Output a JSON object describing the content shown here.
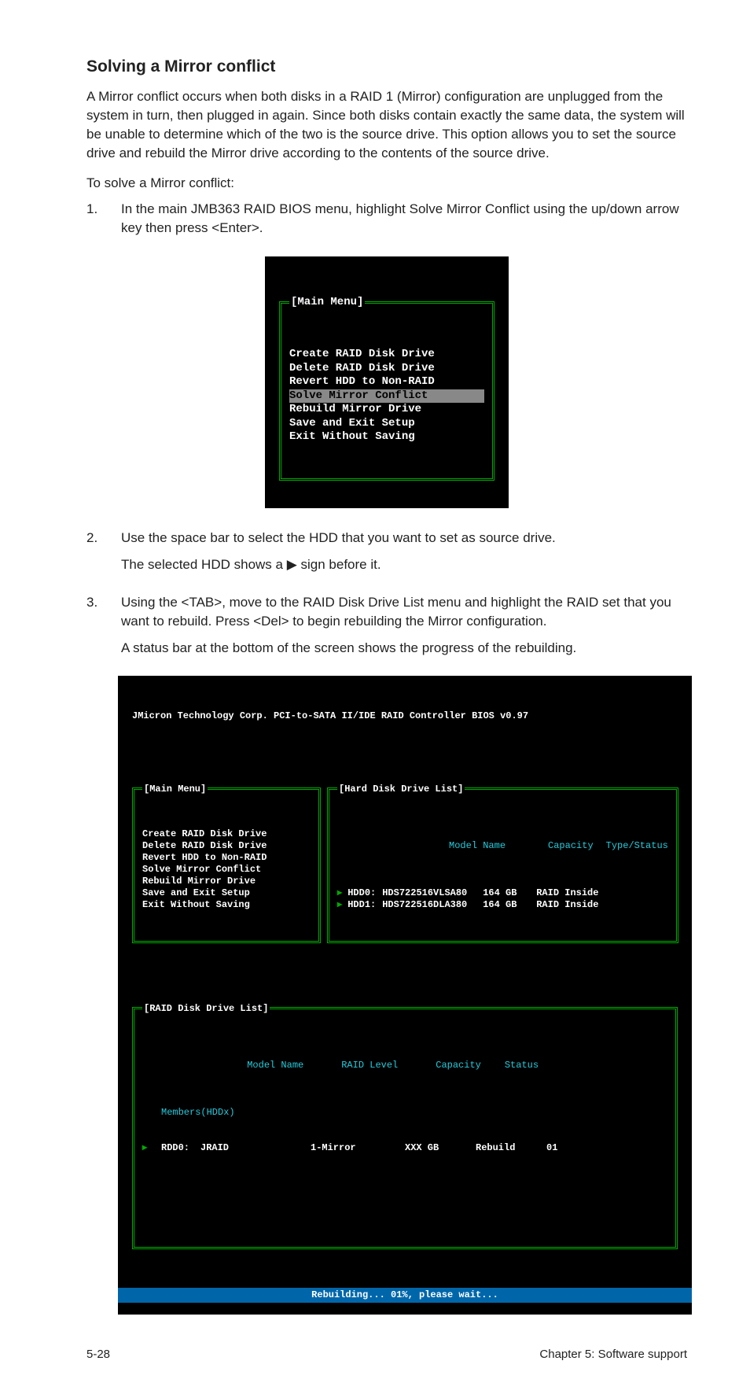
{
  "section": {
    "title": "Solving a Mirror conflict",
    "intro": "A Mirror conflict occurs when both disks in a RAID 1 (Mirror) configuration are unplugged from the system in turn, then plugged in again. Since both disks contain exactly the same data, the system will be unable to determine which of the two is the source drive. This option allows you to set the source drive and rebuild the Mirror drive according to the contents of the source drive.",
    "lead": "To solve a Mirror conflict:",
    "steps": [
      {
        "num": "1.",
        "text": "In the main JMB363 RAID BIOS menu, highlight Solve Mirror Conflict using the up/down arrow key then press <Enter>."
      },
      {
        "num": "2.",
        "text": "Use the space bar to select the HDD that you want to set as source drive.",
        "extra": "The selected HDD shows a ▶ sign before it."
      },
      {
        "num": "3.",
        "text": "Using the <TAB>, move to the RAID Disk Drive List menu and highlight the RAID set that you want to rebuild. Press <Del> to begin rebuilding the Mirror configuration.",
        "extra": "A status bar at the bottom of the screen shows the progress of the rebuilding."
      }
    ]
  },
  "menu1": {
    "title": "[Main Menu]",
    "items": [
      "Create RAID Disk Drive",
      "Delete RAID Disk Drive",
      "Revert HDD to Non-RAID",
      "Solve Mirror Conflict",
      "Rebuild Mirror Drive",
      "Save and Exit Setup",
      "Exit Without Saving"
    ],
    "selected_index": 3
  },
  "term2": {
    "header": "JMicron Technology Corp. PCI-to-SATA II/IDE RAID Controller BIOS v0.97",
    "main_menu_title": "[Main Menu]",
    "main_menu_items": [
      "Create RAID Disk Drive",
      "Delete RAID Disk Drive",
      "Revert HDD to Non-RAID",
      "Solve Mirror Conflict",
      "Rebuild Mirror Drive",
      "Save and Exit Setup",
      "Exit Without Saving"
    ],
    "hdd_panel_title": "[Hard Disk Drive List]",
    "hdd_headers": {
      "model": "Model Name",
      "capacity": "Capacity",
      "type": "Type/Status"
    },
    "hdds": [
      {
        "id": "HDD0:",
        "model": "HDS722516VLSA80",
        "cap": "164 GB",
        "type": "RAID Inside"
      },
      {
        "id": "HDD1:",
        "model": "HDS722516DLA380",
        "cap": "164 GB",
        "type": "RAID Inside"
      }
    ],
    "raid_panel_title": "[RAID Disk Drive List]",
    "raid_headers": {
      "model": "Model Name",
      "level": "RAID Level",
      "capacity": "Capacity",
      "status": "Status"
    },
    "raid_members_label": "Members(HDDx)",
    "raid_rows": [
      {
        "id": "RDD0:",
        "name": "JRAID",
        "level": "1-Mirror",
        "cap": "XXX GB",
        "status": "Rebuild",
        "members": "01"
      }
    ],
    "footer": "Rebuilding... 01%, please wait..."
  },
  "page_footer": {
    "left": "5-28",
    "right": "Chapter 5: Software support"
  }
}
